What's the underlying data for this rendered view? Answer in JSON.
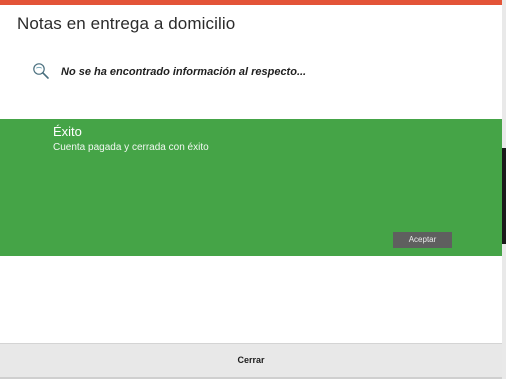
{
  "dialog": {
    "title": "Notas en entrega a domicilio",
    "empty_message": "No se ha encontrado información al respecto...",
    "search_icon": "search-icon"
  },
  "toast": {
    "title": "Éxito",
    "message": "Cuenta pagada y cerrada con éxito",
    "accept_label": "Aceptar",
    "color": "#45a447"
  },
  "footer": {
    "close_label": "Cerrar"
  },
  "colors": {
    "top_accent": "#e35438",
    "toast_green": "#45a447",
    "footer_gray": "#e8e8e8",
    "button_gray": "#5f5f5f"
  }
}
